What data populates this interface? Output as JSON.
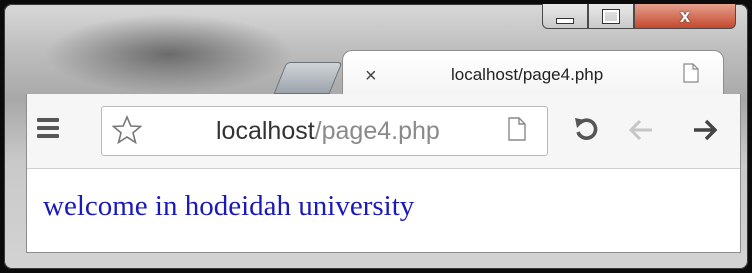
{
  "window": {
    "controls": {
      "minimize_icon": "minimize-icon",
      "maximize_icon": "maximize-icon",
      "close_glyph": "x"
    }
  },
  "tab": {
    "close_glyph": "×",
    "title": "localhost/page4.php",
    "icon": "page-icon"
  },
  "toolbar": {
    "menu_icon": "menu-icon",
    "bookmark_icon": "star-icon",
    "url_host": "localhost",
    "url_path": "/page4.php",
    "page_icon": "page-icon",
    "reload_icon": "reload-icon",
    "back_icon": "back-arrow-icon",
    "forward_icon": "forward-arrow-icon"
  },
  "page": {
    "heading": "welcome in hodeidah university",
    "heading_color": "#1a1ab8"
  }
}
